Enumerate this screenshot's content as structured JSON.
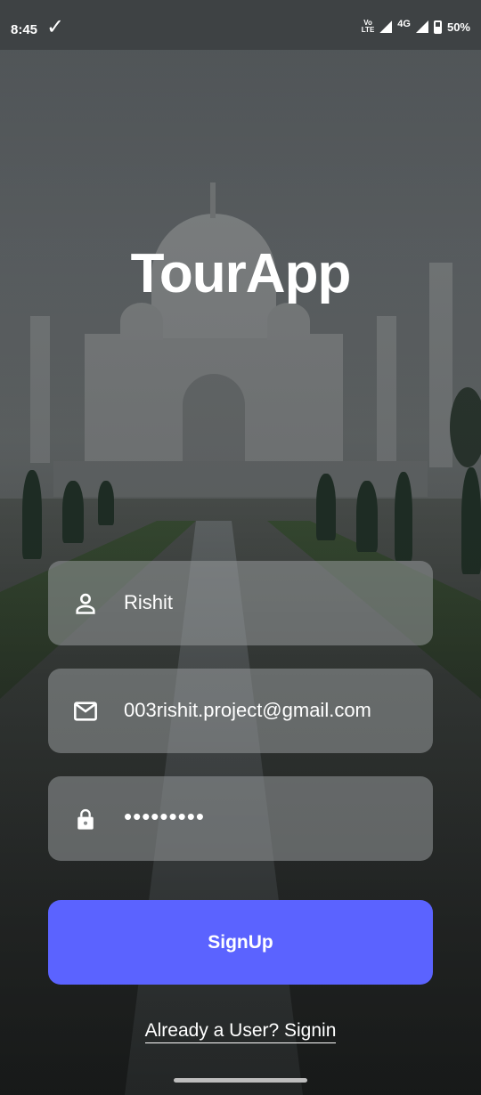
{
  "status_bar": {
    "time": "8:45",
    "volte_top": "Vo",
    "volte_bottom": "LTE",
    "network": "4G",
    "battery": "50%"
  },
  "app": {
    "title": "TourApp"
  },
  "form": {
    "name_value": "Rishit",
    "email_value": "003rishit.project@gmail.com",
    "password_value": "•••••••••",
    "signup_label": "SignUp",
    "signin_link": "Already a User? Signin"
  },
  "colors": {
    "accent": "#5b63ff",
    "field_bg": "#96999b"
  },
  "icons": [
    "person-icon",
    "mail-icon",
    "lock-icon",
    "check-icon",
    "signal-icon",
    "battery-icon"
  ]
}
